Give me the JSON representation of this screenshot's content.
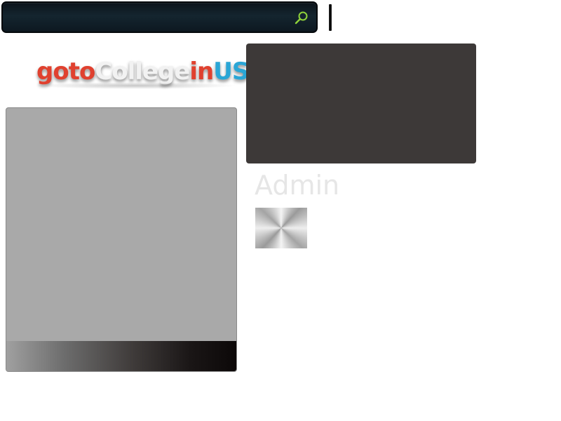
{
  "search": {
    "value": "",
    "placeholder": ""
  },
  "logo": {
    "parts": [
      {
        "text": "goto",
        "color": "#e0412f"
      },
      {
        "text": "College",
        "color": "#f2f2f2"
      },
      {
        "text": "in",
        "color": "#e0412f"
      },
      {
        "text": "US",
        "color": "#2aa6d6"
      }
    ]
  },
  "author": {
    "name": "Admin"
  },
  "icons": {
    "search": "search-icon"
  },
  "colors": {
    "search_bar": "#0f1e27",
    "search_icon": "#8fd23a",
    "feature_box": "#3d3938",
    "side_panel": "#a9a9a9",
    "admin_text": "#e6e6e6"
  }
}
